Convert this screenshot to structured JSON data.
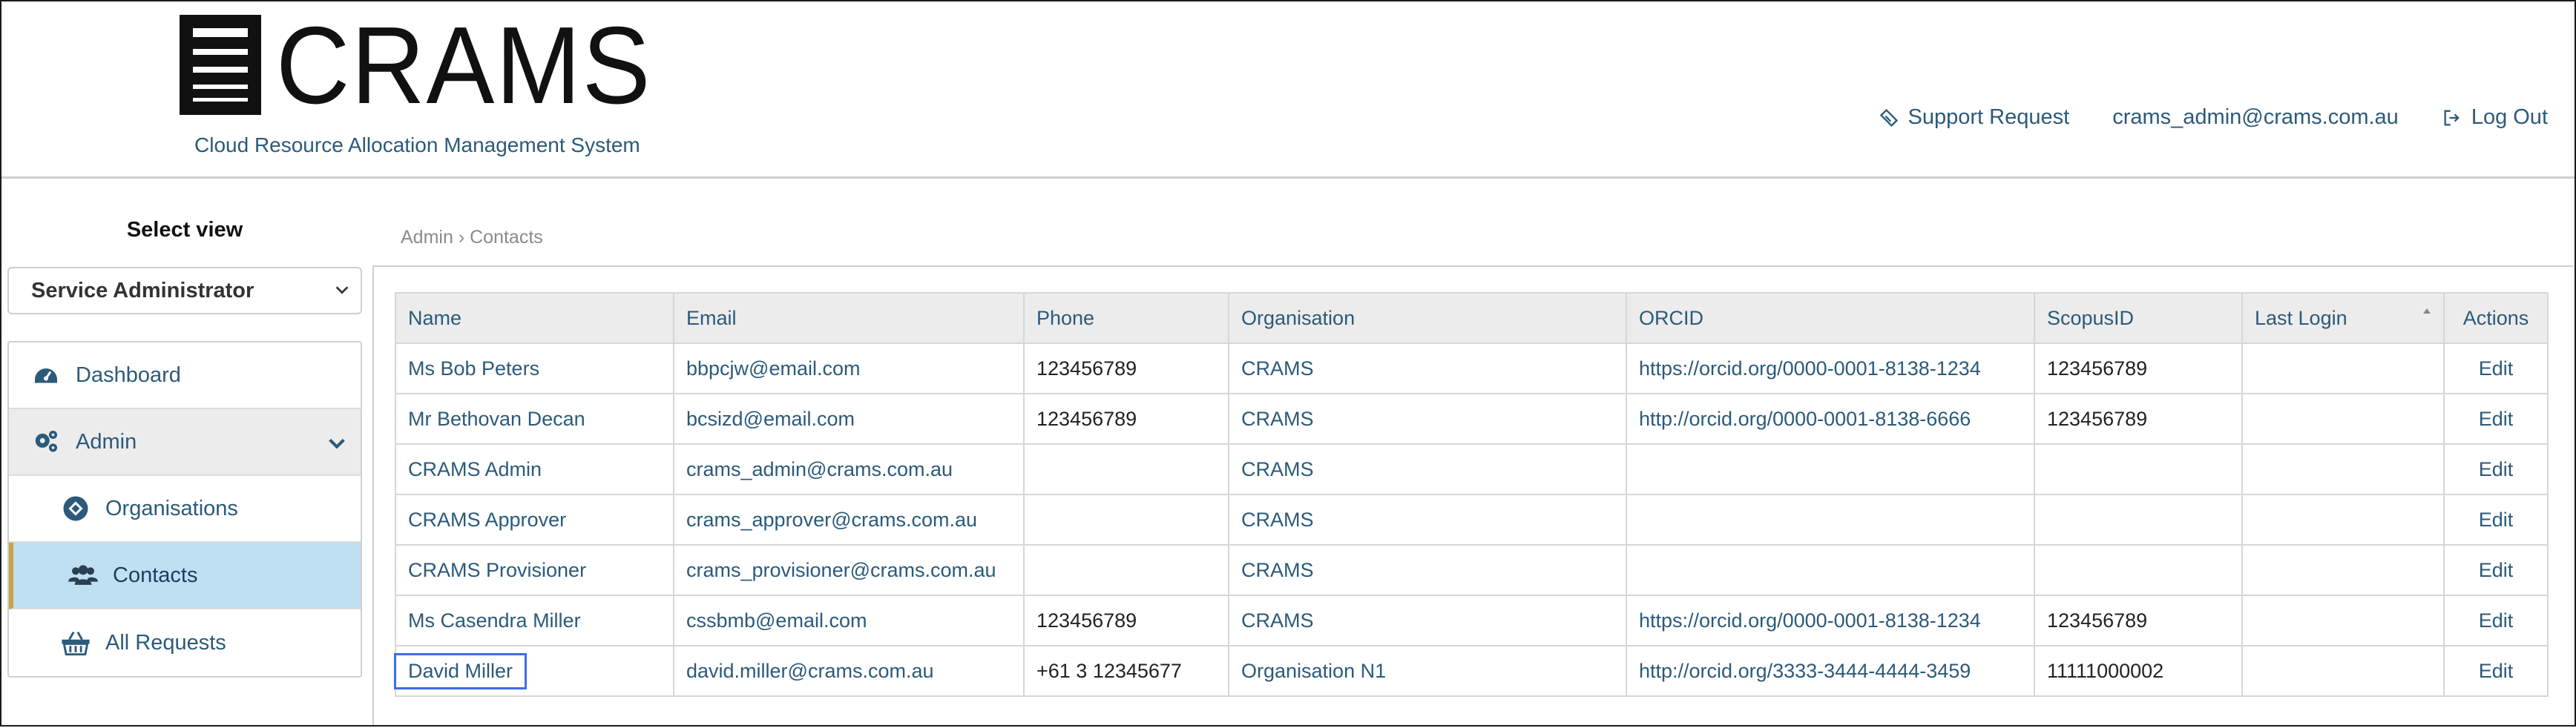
{
  "header": {
    "brand": "CRAMS",
    "tagline": "Cloud Resource Allocation Management System",
    "support_label": "Support Request",
    "user_email": "crams_admin@crams.com.au",
    "logout_label": "Log Out"
  },
  "sidebar": {
    "select_view_title": "Select view",
    "role_selected": "Service Administrator",
    "items": [
      {
        "label": "Dashboard",
        "icon": "dashboard-icon"
      },
      {
        "label": "Admin",
        "icon": "cogs-icon"
      },
      {
        "label": "Organisations",
        "icon": "organisation-icon"
      },
      {
        "label": "Contacts",
        "icon": "users-icon"
      },
      {
        "label": "All Requests",
        "icon": "basket-icon"
      }
    ]
  },
  "breadcrumb": {
    "root": "Admin",
    "separator": "›",
    "current": "Contacts"
  },
  "table": {
    "columns": [
      "Name",
      "Email",
      "Phone",
      "Organisation",
      "ORCID",
      "ScopusID",
      "Last Login",
      "Actions"
    ],
    "rows": [
      {
        "name": "Ms Bob Peters",
        "email": "bbpcjw@email.com",
        "phone": "123456789",
        "org": "CRAMS",
        "orcid": "https://orcid.org/0000-0001-8138-1234",
        "scopus": "123456789",
        "last_login": "",
        "action": "Edit"
      },
      {
        "name": "Mr Bethovan Decan",
        "email": "bcsizd@email.com",
        "phone": "123456789",
        "org": "CRAMS",
        "orcid": "http://orcid.org/0000-0001-8138-6666",
        "scopus": "123456789",
        "last_login": "",
        "action": "Edit"
      },
      {
        "name": "CRAMS Admin",
        "email": "crams_admin@crams.com.au",
        "phone": "",
        "org": "CRAMS",
        "orcid": "",
        "scopus": "",
        "last_login": "",
        "action": "Edit"
      },
      {
        "name": "CRAMS Approver",
        "email": "crams_approver@crams.com.au",
        "phone": "",
        "org": "CRAMS",
        "orcid": "",
        "scopus": "",
        "last_login": "",
        "action": "Edit"
      },
      {
        "name": "CRAMS Provisioner",
        "email": "crams_provisioner@crams.com.au",
        "phone": "",
        "org": "CRAMS",
        "orcid": "",
        "scopus": "",
        "last_login": "",
        "action": "Edit"
      },
      {
        "name": "Ms Casendra Miller",
        "email": "cssbmb@email.com",
        "phone": "123456789",
        "org": "CRAMS",
        "orcid": "https://orcid.org/0000-0001-8138-1234",
        "scopus": "123456789",
        "last_login": "",
        "action": "Edit"
      },
      {
        "name": "David Miller",
        "email": "david.miller@crams.com.au",
        "phone": "+61 3 12345677",
        "org": "Organisation N1",
        "orcid": "http://orcid.org/3333-3444-4444-3459",
        "scopus": "11111000002",
        "last_login": "",
        "action": "Edit"
      }
    ]
  },
  "colors": {
    "link": "#2b5a7a",
    "active_item_bg": "#bfe0f2",
    "active_item_marker": "#c9a24a",
    "focus_outline": "#3b6fe0",
    "header_bg": "#ececec"
  }
}
